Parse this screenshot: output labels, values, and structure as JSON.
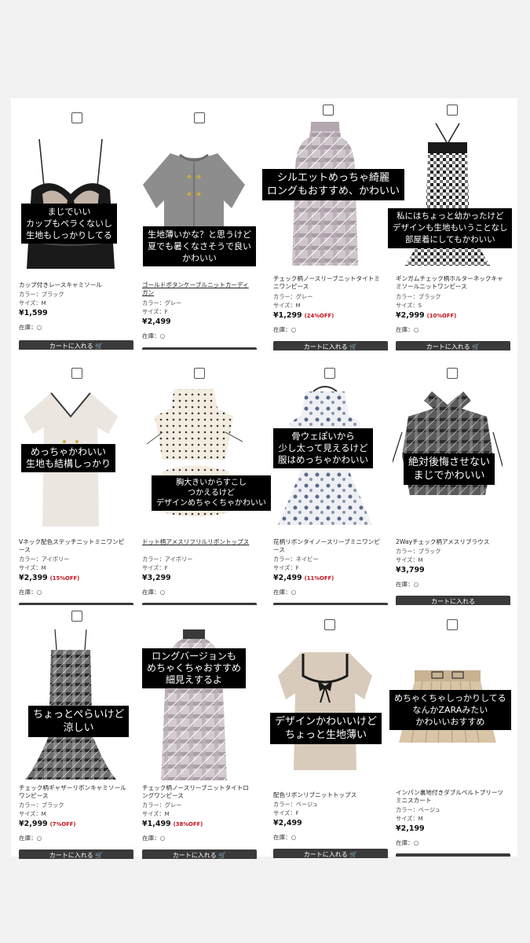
{
  "products": [
    {
      "name": "カップ付きレースキャミソール",
      "color_label": "カラー：ブラック",
      "size_label": "サイズ：M",
      "price": "¥1,599",
      "discount": "",
      "stock": "在庫：○",
      "cart_label": "カートに入れる",
      "linked": false,
      "caption": [
        "まじでいい",
        "カップもペラくないし",
        "生地もしっかりしてる"
      ],
      "image_icon": "black-lace-camisole"
    },
    {
      "name": "ゴールドボタンケーブルニットカーディガン",
      "color_label": "カラー：グレー",
      "size_label": "サイズ：F",
      "price": "¥2,499",
      "discount": "",
      "stock": "在庫：○",
      "cart_label": "",
      "linked": true,
      "caption": [
        "生地薄いかな？と思うけど",
        "夏でも暑くなさそうで良い",
        "かわいい"
      ],
      "image_icon": "grey-knit-cardigan"
    },
    {
      "name": "チェック柄ノースリーブニットタイトミニワンピース",
      "color_label": "カラー：グレー",
      "size_label": "サイズ：M",
      "price": "¥1,299",
      "discount": "(24%OFF)",
      "stock": "在庫：○",
      "cart_label": "カートに入れる",
      "linked": false,
      "caption": [
        "シルエットめっちゃ綺麗",
        "ロングもおすすめ、かわいい"
      ],
      "image_icon": "plaid-mini-dress"
    },
    {
      "name": "ギンガムチェック柄ホルターネックキャミソールニットワンピース",
      "color_label": "カラー：ブラック",
      "size_label": "サイズ：S",
      "price": "¥2,999",
      "discount": "(10%OFF)",
      "stock": "在庫：○",
      "cart_label": "カートに入れる",
      "linked": false,
      "caption": [
        "私にはちょっと幼かったけど",
        "デザインも生地もいうことなし",
        "部屋着にしてもかわいい"
      ],
      "image_icon": "gingham-halter-dress"
    },
    {
      "name": "Vネック配色ステッチニットミニワンピース",
      "color_label": "カラー：アイボリー",
      "size_label": "サイズ：M",
      "price": "¥2,399",
      "discount": "(15%OFF)",
      "stock": "在庫：○",
      "cart_label": "",
      "linked": false,
      "caption": [
        "めっちゃかわいい",
        "生地も結構しっかり"
      ],
      "image_icon": "ivory-knit-dress"
    },
    {
      "name": "ドット柄アメスリフリルリボントップス",
      "color_label": "カラー：アイボリー",
      "size_label": "サイズ：F",
      "price": "¥3,299",
      "discount": "",
      "stock": "在庫：○",
      "cart_label": "",
      "linked": true,
      "caption": [
        "胸大きいからすこし",
        "つかえるけど",
        "デザインめちゃくちゃかわいい"
      ],
      "image_icon": "dot-frill-top"
    },
    {
      "name": "花柄リボンタイノースリーブミニワンピース",
      "color_label": "カラー：ネイビー",
      "size_label": "サイズ：F",
      "price": "¥2,499",
      "discount": "(11%OFF)",
      "stock": "在庫：○",
      "cart_label": "",
      "linked": false,
      "caption": [
        "骨ウェぽいから",
        "少し太って見えるけど",
        "服はめっちゃかわいい"
      ],
      "image_icon": "floral-mini-dress"
    },
    {
      "name": "2Wayチェック柄アメスリブラウス",
      "color_label": "カラー：ブラック",
      "size_label": "サイズ：M",
      "price": "¥3,799",
      "discount": "",
      "stock": "在庫：○",
      "cart_label": "カートに入れる",
      "linked": false,
      "caption": [
        "絶対後悔させない",
        "まじでかわいい"
      ],
      "image_icon": "plaid-blouse"
    },
    {
      "name": "チェック柄ギャザーリボンキャミソールワンピース",
      "color_label": "カラー：ブラック",
      "size_label": "サイズ：M",
      "price": "¥2,999",
      "discount": "(7%OFF)",
      "stock": "在庫：○",
      "cart_label": "カートに入れる",
      "linked": false,
      "caption": [
        "ちょっとぺらいけど",
        "涼しい"
      ],
      "image_icon": "plaid-cami-dress"
    },
    {
      "name": "チェック柄ノースリーブニットタイトロングワンピース",
      "color_label": "カラー：グレー",
      "size_label": "サイズ：M",
      "price": "¥1,499",
      "discount": "(38%OFF)",
      "stock": "在庫：○",
      "cart_label": "カートに入れる",
      "linked": false,
      "caption": [
        "ロングバージョンも",
        "めちゃくちゃおすすめ",
        "細見えするよ"
      ],
      "image_icon": "plaid-long-dress"
    },
    {
      "name": "配色リボンリブニットトップス",
      "color_label": "カラー：ベージュ",
      "size_label": "サイズ：F",
      "price": "¥2,499",
      "discount": "",
      "stock": "在庫：○",
      "cart_label": "カートに入れる",
      "linked": false,
      "caption": [
        "デザインかわいいけど",
        "ちょっと生地薄い"
      ],
      "image_icon": "beige-ribbon-top"
    },
    {
      "name": "インパン裏地付きダブルベルトプリーツミニスカート",
      "color_label": "カラー：ベージュ",
      "size_label": "サイズ：M",
      "price": "¥2,199",
      "discount": "",
      "stock": "在庫：○",
      "cart_label": "カートに入れる",
      "linked": false,
      "caption": [
        "めちゃくちゃしっかりしてる",
        "なんかZARAみたい",
        "かわいいおすすめ"
      ],
      "image_icon": "pleated-mini-skirt"
    }
  ]
}
